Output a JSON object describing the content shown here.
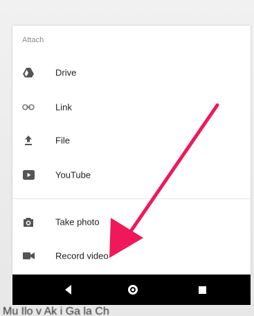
{
  "sheet": {
    "title": "Attach",
    "items": [
      {
        "label": "Drive",
        "icon": "drive-icon"
      },
      {
        "label": "Link",
        "icon": "link-icon"
      },
      {
        "label": "File",
        "icon": "upload-icon"
      },
      {
        "label": "YouTube",
        "icon": "youtube-icon"
      },
      {
        "label": "Take photo",
        "icon": "camera-icon"
      },
      {
        "label": "Record video",
        "icon": "video-camera-icon"
      }
    ]
  },
  "navbar": {
    "back": "back-icon",
    "home": "home-icon",
    "recents": "recents-icon"
  },
  "caption": "Mu Ilo v Ak i Ga la Ch",
  "colors": {
    "arrow": "#f0185a",
    "navbar": "#000000",
    "icon": "#555555"
  }
}
